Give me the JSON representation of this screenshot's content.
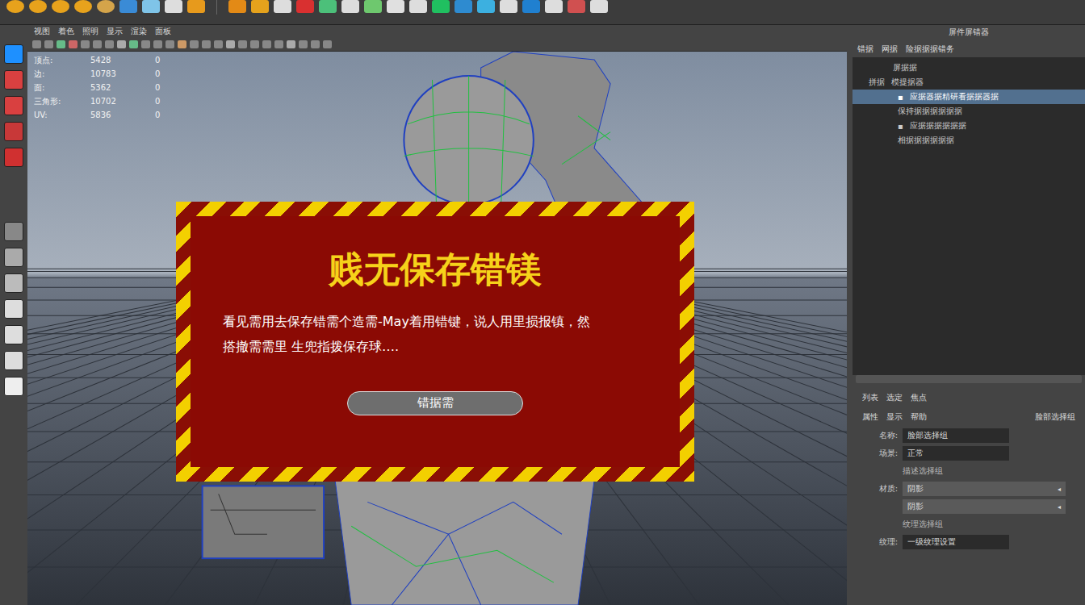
{
  "viewport": {
    "menu": [
      "视图",
      "着色",
      "照明",
      "显示",
      "渲染",
      "面板"
    ],
    "hud": [
      {
        "label": "顶点:",
        "value": "5428",
        "count": "0"
      },
      {
        "label": "边:",
        "value": "10783",
        "count": "0"
      },
      {
        "label": "面:",
        "value": "5362",
        "count": "0"
      },
      {
        "label": "三角形:",
        "value": "10702",
        "count": "0"
      },
      {
        "label": "UV:",
        "value": "5836",
        "count": "0"
      }
    ]
  },
  "dialog": {
    "title": "贱无保存错镁",
    "message_lines": [
      "看见需用去保存错需个造需-May着用错键，说人用里损报镇，然",
      "搭撤需需里 生兜指拨保存球…."
    ],
    "button": "错据需"
  },
  "outliner": {
    "title": "屏件屏错器",
    "tabs": [
      "错据",
      "网据",
      "险据据据错务"
    ],
    "header": "屏据据",
    "items": [
      {
        "label": "模提据器",
        "prefix": "拼据",
        "selected": false,
        "expandable": false
      },
      {
        "label": "应据器据精研看据据器据",
        "prefix": "",
        "selected": true,
        "expandable": true
      },
      {
        "label": "保持据据据据据据",
        "prefix": "",
        "selected": false,
        "expandable": false
      },
      {
        "label": "应据据据据据据",
        "prefix": "",
        "selected": false,
        "expandable": true
      },
      {
        "label": "相据据据据据据",
        "prefix": "",
        "selected": false,
        "expandable": false
      }
    ]
  },
  "attributes": {
    "tabs": [
      "列表",
      "选定",
      "焦点"
    ],
    "subtabs": [
      "属性",
      "显示",
      "帮助"
    ],
    "node": "脸部选择组",
    "rows": [
      {
        "kind": "field",
        "label": "名称:",
        "value": "脸部选择组"
      },
      {
        "kind": "field",
        "label": "场景:",
        "value": "正常"
      },
      {
        "kind": "note",
        "label": "",
        "value": "描述选择组"
      },
      {
        "kind": "select",
        "label": "材质:",
        "value": "阴影"
      },
      {
        "kind": "select",
        "label": "",
        "value": "阴影"
      },
      {
        "kind": "note",
        "label": "",
        "value": "纹理选择组"
      },
      {
        "kind": "field",
        "label": "纹理:",
        "value": "一级纹理设置"
      }
    ]
  }
}
